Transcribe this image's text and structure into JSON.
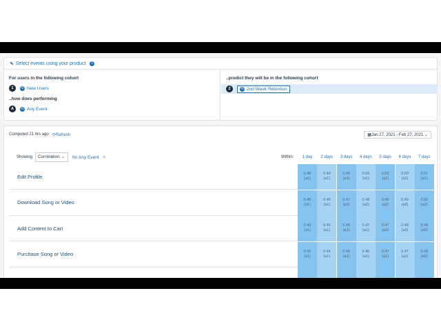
{
  "top": {
    "header": "Select events using your product",
    "left_label": "For users in the following cohort",
    "left_cohort_num": "1",
    "left_cohort": "New Users",
    "left_label2": "..how does performing",
    "event_badge": "A",
    "event_name": "Any Event",
    "right_label": "..predict they will be in the following cohort",
    "right_cohort_num": "2",
    "right_cohort": "2nd Week Retention"
  },
  "toolbar": {
    "computed": "Computed 21 hrs ago",
    "refresh": "Refresh",
    "date_range": "Jan 27, 2021 - Feb 27, 2021",
    "showing": "Showing",
    "select_value": "Correlation",
    "for_event": "for Any Event",
    "within": "Within:"
  },
  "days": [
    "1 day",
    "2 days",
    "3 days",
    "4 days",
    "5 days",
    "6 days",
    "7 days"
  ],
  "rows": [
    {
      "name": "Edit Profile",
      "cells": [
        [
          "0.48",
          "(a1)"
        ],
        [
          "0.49",
          "(a1)"
        ],
        [
          "0.49",
          "(a1)"
        ],
        [
          "0.50",
          "(a1)"
        ],
        [
          "0.50",
          "(a1)"
        ],
        [
          "0.50",
          "(a1)"
        ],
        [
          "0.51",
          "(a1)"
        ]
      ]
    },
    {
      "name": "Download Song or Video",
      "cells": [
        [
          "0.45",
          "(a1)"
        ],
        [
          "0.46",
          "(a1)"
        ],
        [
          "0.47",
          "(a1)"
        ],
        [
          "0.48",
          "(a2)"
        ],
        [
          "0.49",
          "(a2)"
        ],
        [
          "0.49",
          "(a2)"
        ],
        [
          "0.50",
          "(a2)"
        ]
      ]
    },
    {
      "name": "Add Content to Cart",
      "cells": [
        [
          "0.43",
          "(a1)"
        ],
        [
          "0.45",
          "(a1)"
        ],
        [
          "0.46",
          "(a1)"
        ],
        [
          "0.47",
          "(a1)"
        ],
        [
          "0.47",
          "(a2)"
        ],
        [
          "0.48",
          "(a2)"
        ],
        [
          "0.49",
          "(a2)"
        ]
      ]
    },
    {
      "name": "Purchase Song or Video",
      "cells": [
        [
          "0.41",
          "(a1)"
        ],
        [
          "0.44",
          "(a1)"
        ],
        [
          "0.45",
          "(a1)"
        ],
        [
          "0.46",
          "(a1)"
        ],
        [
          "0.47",
          "(a1)"
        ],
        [
          "0.47",
          "(a1)"
        ],
        [
          "0.48",
          "(a2)"
        ]
      ]
    }
  ],
  "colors": {
    "accent": "#1f6fb4",
    "cell_light": "#a6d3f2",
    "cell_dark": "#86c4ef"
  }
}
